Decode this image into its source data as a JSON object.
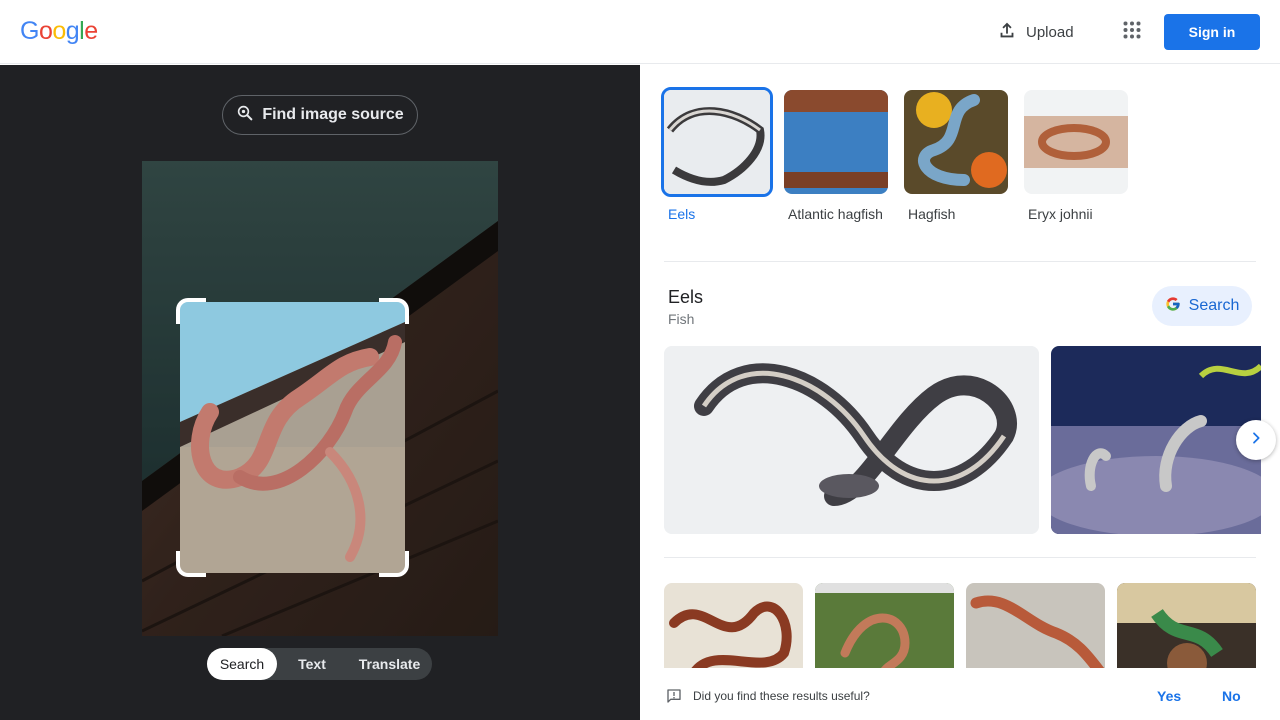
{
  "header": {
    "logo": [
      "G",
      "o",
      "o",
      "g",
      "l",
      "e"
    ],
    "logo_colors": [
      "#4285f4",
      "#ea4335",
      "#fbbc05",
      "#4285f4",
      "#34a853",
      "#ea4335"
    ],
    "upload_label": "Upload",
    "signin_label": "Sign in"
  },
  "left_panel": {
    "find_source_label": "Find image source",
    "modes": [
      "Search",
      "Text",
      "Translate"
    ],
    "active_mode": "Search"
  },
  "related": {
    "chips": [
      {
        "label": "Eels",
        "active": true
      },
      {
        "label": "Atlantic hagfish",
        "active": false
      },
      {
        "label": "Hagfish",
        "active": false
      },
      {
        "label": "Eryx johnii",
        "active": false
      }
    ]
  },
  "entity": {
    "title": "Eels",
    "subtitle": "Fish",
    "search_label": "Search"
  },
  "feedback": {
    "question": "Did you find these results useful?",
    "yes": "Yes",
    "no": "No"
  },
  "colors": {
    "accent": "#1a73e8",
    "dark_panel": "#202124"
  },
  "icons": [
    "upload-icon",
    "apps-grid-icon",
    "lens-search-icon",
    "google-g-icon",
    "chevron-right-icon",
    "feedback-icon"
  ]
}
